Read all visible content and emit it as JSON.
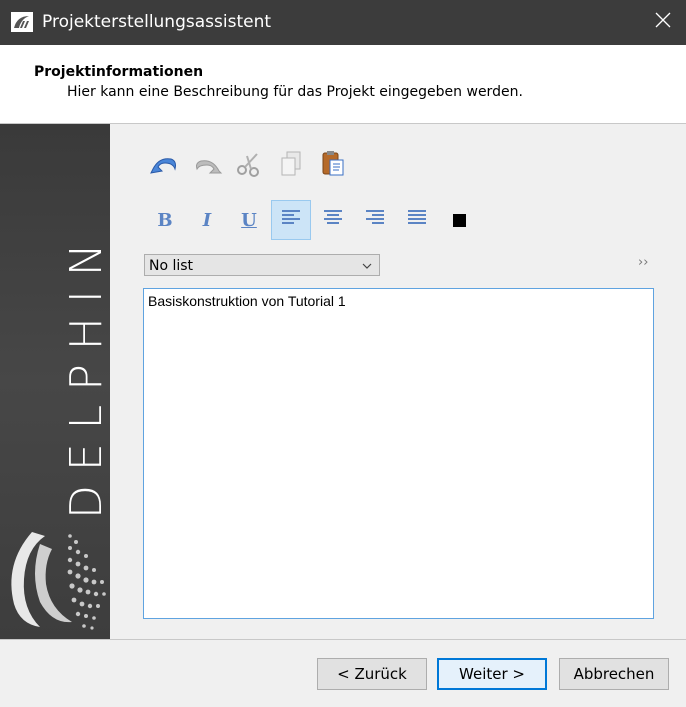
{
  "window": {
    "title": "Projekterstellungsassistent",
    "app_icon": "delphin-app-icon",
    "close_icon": "close-icon"
  },
  "header": {
    "title": "Projektinformationen",
    "subtitle": "Hier kann eine Beschreibung für das Projekt eingegeben werden."
  },
  "sidebar": {
    "brand_text": "DELPHIN",
    "logo": "delphin-logo"
  },
  "toolbar": {
    "edit_icons": [
      "undo-icon",
      "redo-icon",
      "cut-icon",
      "copy-icon",
      "paste-icon"
    ],
    "bold_label": "B",
    "italic_label": "I",
    "underline_label": "U",
    "align_icons": [
      "align-left-icon",
      "align-center-icon",
      "align-right-icon",
      "align-justify-icon"
    ],
    "active_align": "align-left-icon",
    "color_swatch": "#000000"
  },
  "list_select": {
    "value": "No list",
    "more_label": "››"
  },
  "editor": {
    "text": "Basiskonstruktion von Tutorial 1"
  },
  "buttons": {
    "back": "< Zurück",
    "next": "Weiter >",
    "cancel": "Abbrechen"
  },
  "colors": {
    "titlebar": "#3c3c3c",
    "sidebar": "#404040",
    "accent": "#0078d7"
  }
}
